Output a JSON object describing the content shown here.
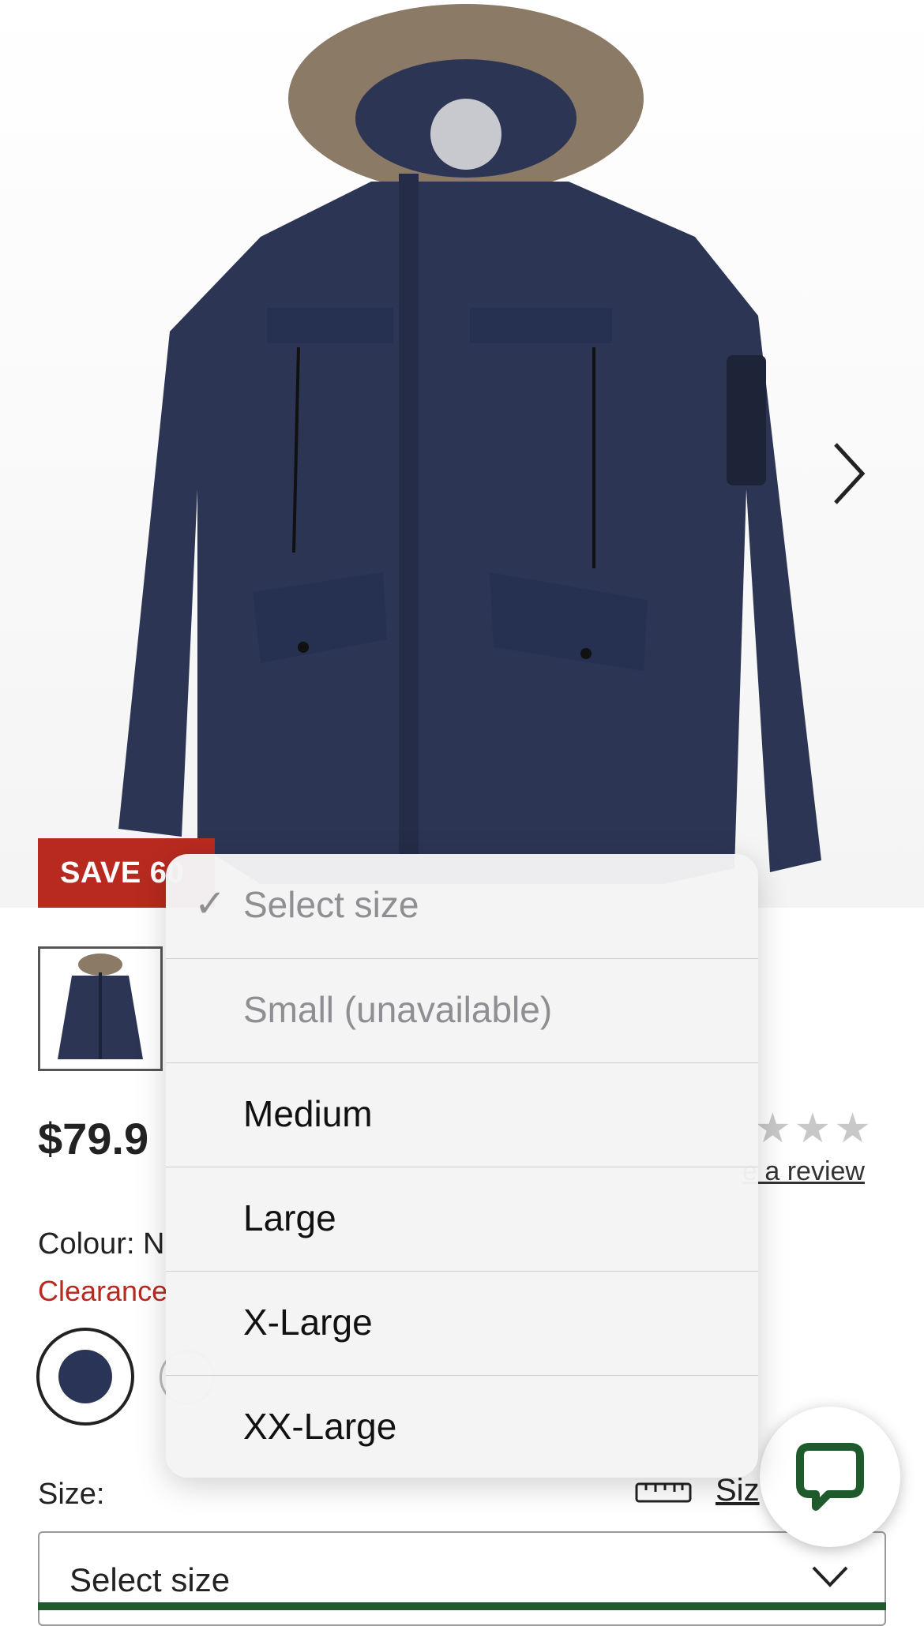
{
  "product": {
    "badge": "SAVE 60",
    "price": "$79.9",
    "rating_stars": "★★★",
    "review_link": "e a review",
    "colour_label": "Colour: N",
    "clearance": "Clearance",
    "colour_swatch": "#2a3456",
    "icons": {
      "next": "chevron-right-icon",
      "chat": "chat-bubble-icon",
      "ruler": "ruler-icon",
      "chevron_down": "chevron-down-icon"
    }
  },
  "size": {
    "label": "Size:",
    "guide_link": "Siz",
    "select_value": "Select size"
  },
  "dropdown": {
    "check_mark": "✓",
    "options": [
      {
        "label": "Select size",
        "state": "selected-placeholder"
      },
      {
        "label": "Small (unavailable)",
        "state": "disabled"
      },
      {
        "label": "Medium",
        "state": "enabled"
      },
      {
        "label": "Large",
        "state": "enabled"
      },
      {
        "label": "X-Large",
        "state": "enabled"
      },
      {
        "label": "XX-Large",
        "state": "enabled"
      }
    ]
  },
  "colors": {
    "badge_red": "#b82a1f",
    "chat_green": "#1f5a2c",
    "jacket_navy": "#2d3555"
  }
}
